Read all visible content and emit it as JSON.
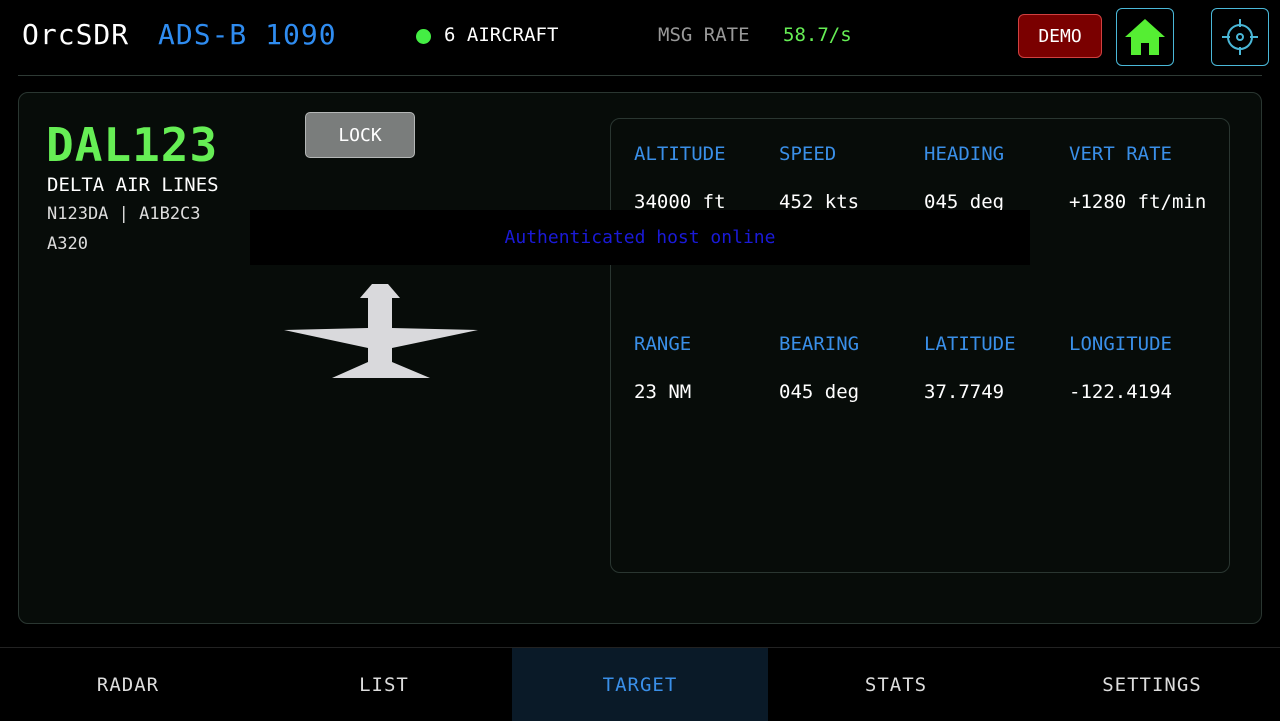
{
  "header": {
    "app_title": "OrcSDR",
    "mode_title": "ADS-B 1090",
    "aircraft_count": "6 AIRCRAFT",
    "msg_rate_label": "MSG RATE",
    "msg_rate_value": "58.7/s",
    "demo_label": "DEMO",
    "home_icon": "home-icon",
    "locate_icon": "crosshair-icon"
  },
  "target": {
    "callsign": "DAL123",
    "airline": "DELTA AIR LINES",
    "registration_line": "N123DA | A1B2C3",
    "aircraft_type": "A320",
    "lock_label": "LOCK"
  },
  "data": {
    "row1": [
      {
        "label": "ALTITUDE",
        "value": "34000 ft"
      },
      {
        "label": "SPEED",
        "value": "452 kts"
      },
      {
        "label": "HEADING",
        "value": "045 deg"
      },
      {
        "label": "VERT RATE",
        "value": "+1280 ft/min"
      }
    ],
    "row2": [
      {
        "label": "RANGE",
        "value": "23 NM"
      },
      {
        "label": "BEARING",
        "value": "045 deg"
      },
      {
        "label": "LATITUDE",
        "value": "37.7749"
      },
      {
        "label": "LONGITUDE",
        "value": "-122.4194"
      }
    ]
  },
  "toast": {
    "text": "Authenticated host online"
  },
  "nav": {
    "tabs": [
      {
        "label": "RADAR"
      },
      {
        "label": "LIST"
      },
      {
        "label": "TARGET"
      },
      {
        "label": "STATS"
      },
      {
        "label": "SETTINGS"
      }
    ],
    "active": "TARGET"
  },
  "colors": {
    "accent_blue": "#3a8fe8",
    "accent_green": "#66ee55",
    "demo_red": "#7a0000",
    "toast_text": "#1a1ad8"
  }
}
